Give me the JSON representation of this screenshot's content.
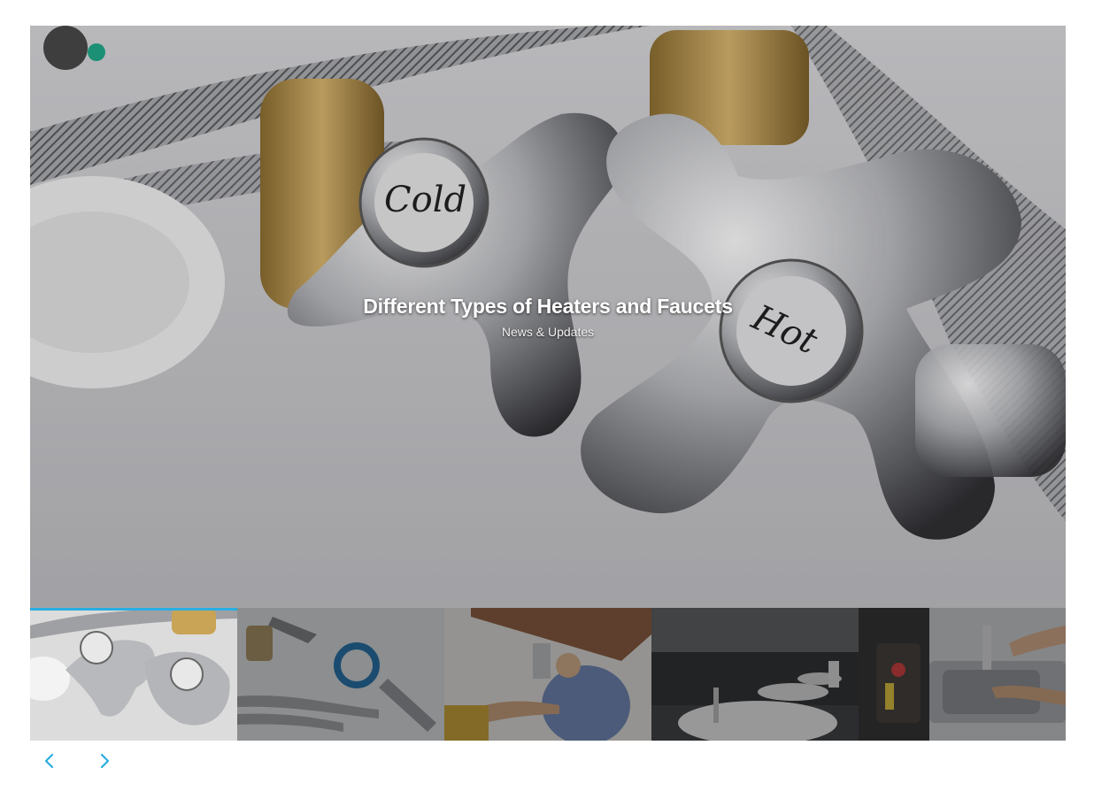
{
  "slider": {
    "active_index": 0,
    "slides": [
      {
        "title": "Different Types of Heaters and Faucets",
        "category": "News & Updates"
      }
    ],
    "hero_image_labels": {
      "cold": "Cold",
      "hot": "Hot"
    }
  },
  "thumbnails": [
    {
      "name": "thumb-faucet-handles"
    },
    {
      "name": "thumb-plumbing-tools"
    },
    {
      "name": "thumb-plumber-under-sink"
    },
    {
      "name": "thumb-bathroom-sinks"
    },
    {
      "name": "thumb-kitchen-faucet-repair"
    }
  ],
  "nav": {
    "prev_icon": "chevron-left-icon",
    "next_icon": "chevron-right-icon"
  },
  "colors": {
    "accent": "#29aee0",
    "caption_text": "#ffffff",
    "overlay": "#282830"
  }
}
